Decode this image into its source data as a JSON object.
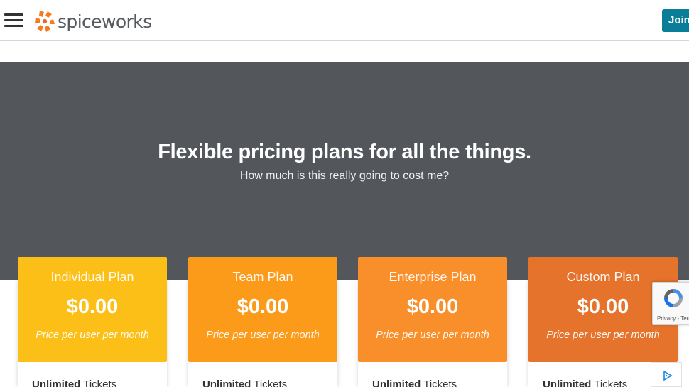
{
  "header": {
    "logo_text": "spiceworks",
    "join_label": "Join",
    "menu_icon": "hamburger-icon",
    "logo_icon": "spiceworks-logo-icon"
  },
  "hero": {
    "title": "Flexible pricing plans for all the things.",
    "subtitle": "How much is this really going to cost me?"
  },
  "plans": [
    {
      "name": "Individual Plan",
      "price": "$0.00",
      "note": "Price per user per month",
      "color": "#fcbf17",
      "feature_bold": "Unlimited",
      "feature_text": " Tickets"
    },
    {
      "name": "Team Plan",
      "price": "$0.00",
      "note": "Price per user per month",
      "color": "#fc9a1a",
      "feature_bold": "Unlimited",
      "feature_text": " Tickets"
    },
    {
      "name": "Enterprise Plan",
      "price": "$0.00",
      "note": "Price per user per month",
      "color": "#f98f2a",
      "feature_bold": "Unlimited",
      "feature_text": " Tickets"
    },
    {
      "name": "Custom Plan",
      "price": "$0.00",
      "note": "Price per user per month",
      "color": "#e5732c",
      "feature_bold": "Unlimited",
      "feature_text": " Tickets"
    }
  ],
  "recaptcha": {
    "links": "Privacy - Terms",
    "icon": "recaptcha-icon"
  },
  "ad": {
    "icon": "adchoices-icon"
  },
  "colors": {
    "hero_bg": "#53575b",
    "join_bg": "#0a7d98",
    "logo_orange": "#f47b20"
  }
}
